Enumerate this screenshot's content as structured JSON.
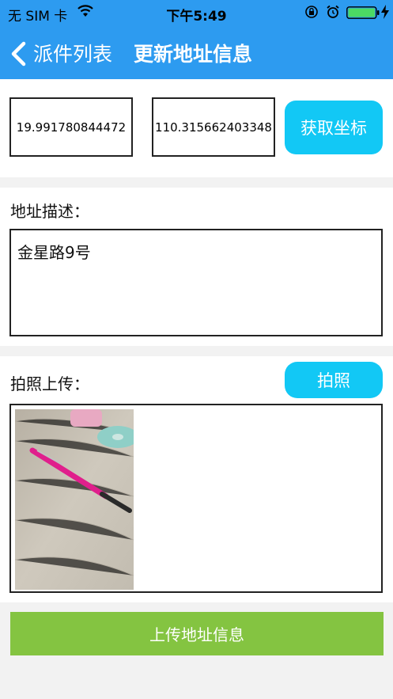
{
  "status_bar": {
    "carrier": "无 SIM 卡",
    "time": "下午5:49",
    "wifi_icon": "wifi-icon",
    "lock_icon": "rotation-lock-icon",
    "alarm_icon": "alarm-icon",
    "battery_icon": "battery-icon",
    "battery_color": "#4cd964"
  },
  "nav": {
    "back_label": "派件列表",
    "title": "更新地址信息",
    "bar_color": "#2d9bf0"
  },
  "coords": {
    "latitude": "19.991780844472",
    "longitude": "110.315662403348",
    "get_button": "获取坐标"
  },
  "address": {
    "label": "地址描述：",
    "value": "金星路9号"
  },
  "photo": {
    "label": "拍照上传：",
    "take_button": "拍照"
  },
  "submit": {
    "label": "上传地址信息",
    "color": "#84c441"
  },
  "accent_color": "#12c8f5"
}
